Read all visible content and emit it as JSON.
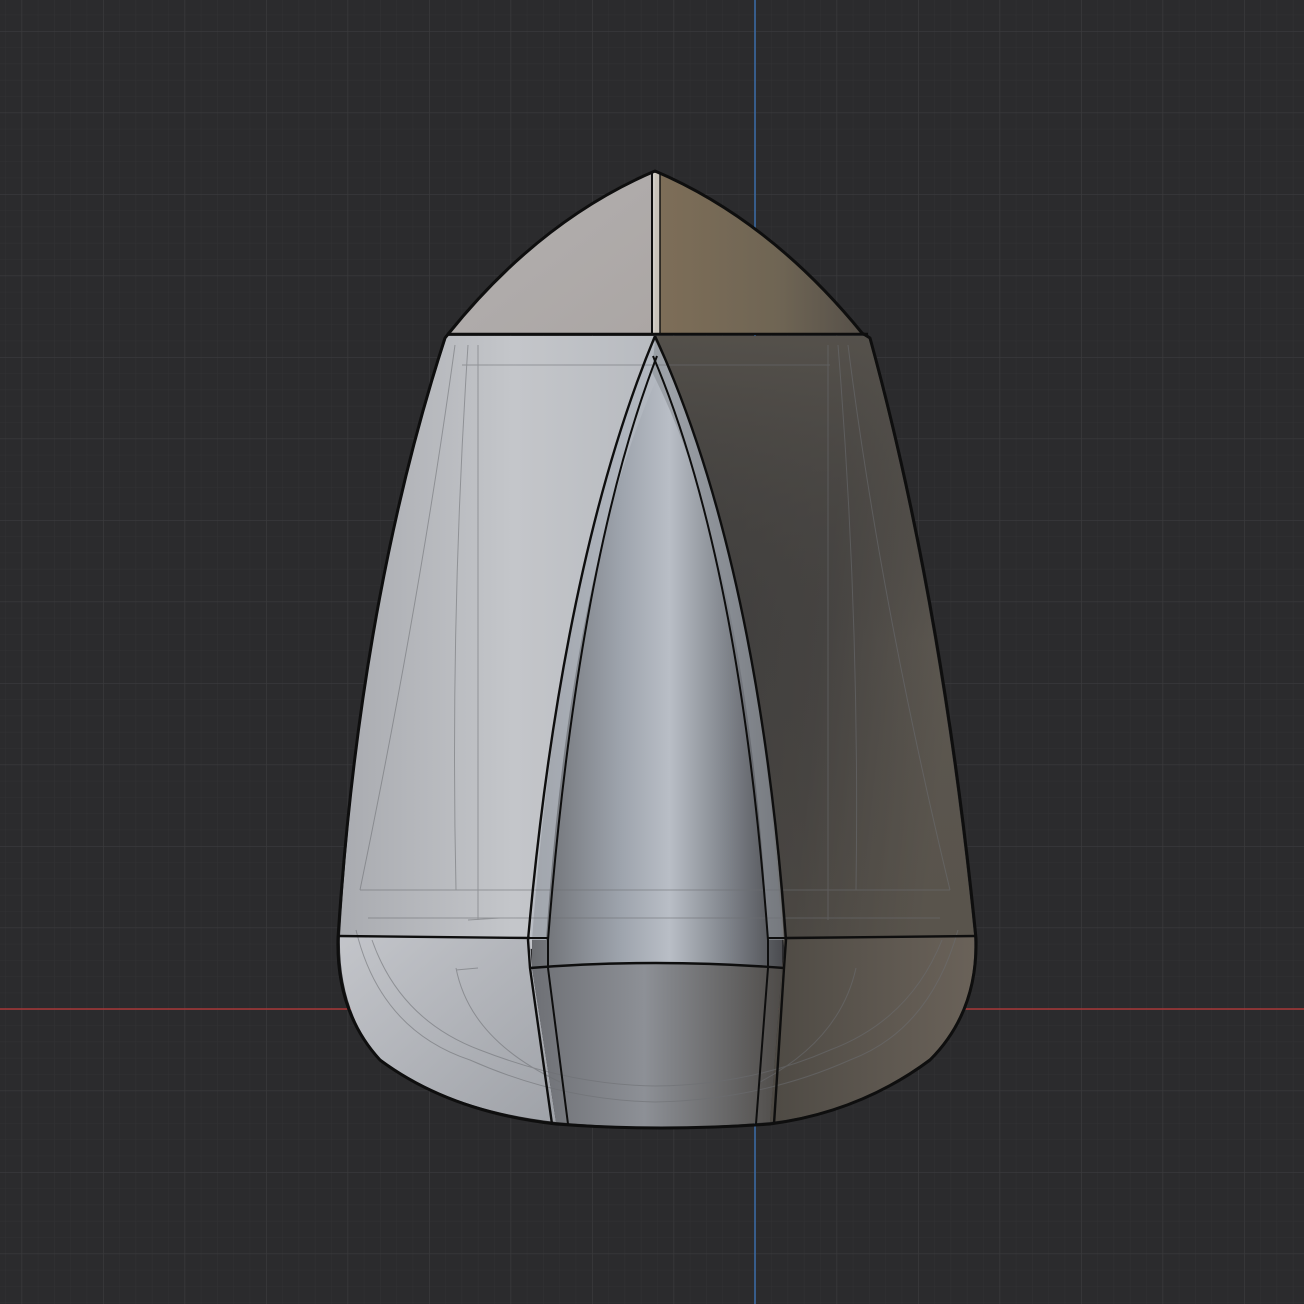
{
  "viewport": {
    "background_color": "#2b2b2d",
    "grid_minor_color": "#323234",
    "grid_major_color": "#3a3a3c",
    "axis_x_color": "#b23a3a",
    "axis_z_color": "#3c6ea8",
    "view_mode": "solid-shading-with-wireframe-xray"
  },
  "object": {
    "kind": "faceted-bullet-mesh",
    "outline_color": "#0d0d0d",
    "light_face_color": "#c2c4c8",
    "dark_face_color": "#5a5650",
    "warm_tint_color": "#8a7a62"
  }
}
